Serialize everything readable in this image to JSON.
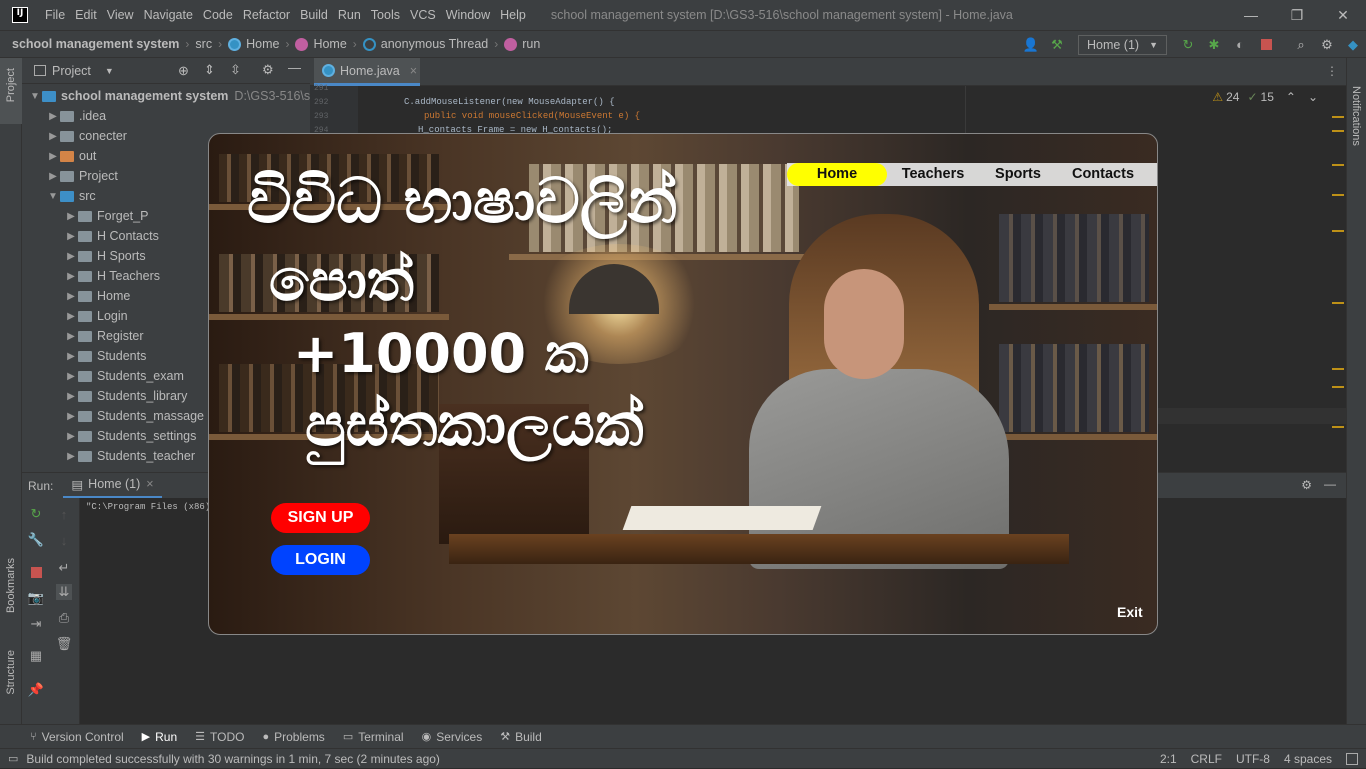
{
  "titlebar": {
    "logo": "IJ",
    "menu": [
      "File",
      "Edit",
      "View",
      "Navigate",
      "Code",
      "Refactor",
      "Build",
      "Run",
      "Tools",
      "VCS",
      "Window",
      "Help"
    ],
    "window_title": "school management system [D:\\GS3-516\\school management system] - Home.java",
    "controls": [
      "—",
      "❐",
      "✕"
    ]
  },
  "breadcrumb": {
    "project": "school management system",
    "items": [
      "src",
      "Home",
      "Home",
      "anonymous Thread",
      "run"
    ]
  },
  "toolbar": {
    "run_config": "Home (1)"
  },
  "project_panel": {
    "title": "Project",
    "root": "school management system",
    "root_path": "D:\\GS3-516\\scho",
    "items": [
      {
        "label": ".idea",
        "depth": 1,
        "folder": "gray"
      },
      {
        "label": "conecter",
        "depth": 1,
        "folder": "gray"
      },
      {
        "label": "out",
        "depth": 1,
        "folder": "orange"
      },
      {
        "label": "Project",
        "depth": 1,
        "folder": "gray"
      },
      {
        "label": "src",
        "depth": 1,
        "folder": "blue",
        "open": true
      },
      {
        "label": "Forget_P",
        "depth": 2,
        "folder": "gray"
      },
      {
        "label": "H Contacts",
        "depth": 2,
        "folder": "gray"
      },
      {
        "label": "H Sports",
        "depth": 2,
        "folder": "gray"
      },
      {
        "label": "H Teachers",
        "depth": 2,
        "folder": "gray"
      },
      {
        "label": "Home",
        "depth": 2,
        "folder": "gray"
      },
      {
        "label": "Login",
        "depth": 2,
        "folder": "gray"
      },
      {
        "label": "Register",
        "depth": 2,
        "folder": "gray"
      },
      {
        "label": "Students",
        "depth": 2,
        "folder": "gray"
      },
      {
        "label": "Students_exam",
        "depth": 2,
        "folder": "gray"
      },
      {
        "label": "Students_library",
        "depth": 2,
        "folder": "gray"
      },
      {
        "label": "Students_massage",
        "depth": 2,
        "folder": "gray"
      },
      {
        "label": "Students_settings",
        "depth": 2,
        "folder": "gray"
      },
      {
        "label": "Students_teacher",
        "depth": 2,
        "folder": "gray"
      }
    ]
  },
  "editor": {
    "tab": "Home.java",
    "line_numbers": [
      "291",
      "292",
      "293",
      "294"
    ],
    "code": [
      "",
      "C.addMouseListener(new MouseAdapter() {",
      "    public void mouseClicked(MouseEvent e) {",
      "  H_contacts Frame = new H_contacts();"
    ],
    "warnings": "24",
    "weak_warnings": "15"
  },
  "run_panel": {
    "label": "Run:",
    "tab": "Home (1)",
    "console": "\"C:\\Program Files (x86)\\"
  },
  "side_labels": {
    "left_top": "Project",
    "left_mid": "Bookmarks",
    "left_bottom": "Structure",
    "right": "Notifications"
  },
  "bottom_tabs": [
    "Version Control",
    "Run",
    "TODO",
    "Problems",
    "Terminal",
    "Services",
    "Build"
  ],
  "status": {
    "message": "Build completed successfully with 30 warnings in 1 min, 7 sec (2 minutes ago)",
    "position": "2:1",
    "line_sep": "CRLF",
    "encoding": "UTF-8",
    "indent": "4 spaces"
  },
  "app": {
    "headline": [
      "විවිධ භාෂාවලින්",
      "පොත්",
      "+10000 ක",
      "පුස්තකාලයක්"
    ],
    "nav": [
      "Home",
      "Teachers",
      "Sports",
      "Contacts"
    ],
    "signup": "SIGN UP",
    "login": "LOGIN",
    "exit": "Exit",
    "colors": {
      "nav_active": "#ffff00",
      "signup": "#ff0000",
      "login": "#0043ff"
    }
  }
}
